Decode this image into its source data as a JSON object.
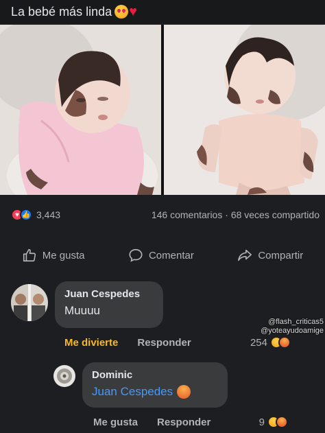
{
  "post": {
    "title": "La bebé más linda",
    "title_icons": [
      "heart-eyes-emoji",
      "red-heart-emoji"
    ]
  },
  "photos": [
    {
      "icon": "baby-photo-left"
    },
    {
      "icon": "baby-photo-right"
    }
  ],
  "stats": {
    "reactions_count": "3,443",
    "comments": "146 comentarios",
    "separator": "·",
    "shares": "68 veces compartido"
  },
  "actions": {
    "like": "Me gusta",
    "comment": "Comentar",
    "share": "Compartir"
  },
  "comments": [
    {
      "author": "Juan Cespedes",
      "text": "Muuuu",
      "reaction_label": "Me divierte",
      "reply_label": "Responder",
      "reaction_count": "254"
    },
    {
      "author": "Dominic",
      "mention": "Juan Cespedes",
      "reaction_label": "Me gusta",
      "reply_label": "Responder",
      "reaction_count": "9"
    }
  ],
  "watermark": {
    "line1": "@flash_criticas5",
    "line2": "@yoteayudoamige"
  },
  "colors": {
    "background": "#1c1e21",
    "bubble": "#3a3b3c",
    "link": "#4599ff",
    "orange_reaction": "#f7b928"
  }
}
